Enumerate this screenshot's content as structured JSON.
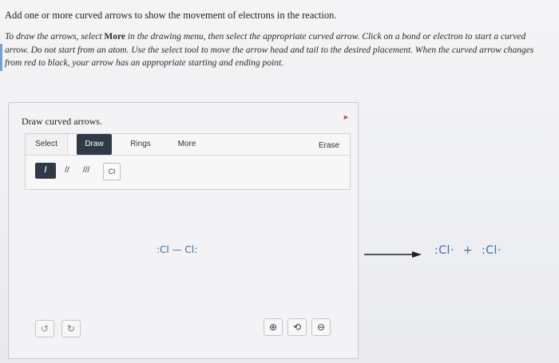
{
  "question": {
    "title": "Add one or more curved arrows to show the movement of electrons in the reaction.",
    "instructions_part1": "To draw the arrows, select ",
    "instructions_bold": "More",
    "instructions_part2": " in the drawing menu, then select the appropriate curved arrow. Click on a bond or electron to start a curved arrow. Do not start from an atom. Use the select tool to move the arrow head and tail to the desired placement. When the curved arrow changes from red to black, your arrow has an appropriate starting and ending point."
  },
  "panel": {
    "title": "Draw curved arrows.",
    "tabs": {
      "select": "Select",
      "draw": "Draw",
      "rings": "Rings",
      "more": "More",
      "erase": "Erase"
    },
    "tools": {
      "single_bond": "/",
      "double_bond": "//",
      "triple_bond": "///",
      "element": "Cl"
    },
    "reactant": ":Cl — Cl:",
    "undo_icon": "undo-icon",
    "redo_icon": "redo-icon",
    "zoom": {
      "in_icon": "zoom-in-icon",
      "reset_icon": "zoom-reset-icon",
      "out_icon": "zoom-out-icon"
    }
  },
  "products": {
    "product1": ":Cl·",
    "plus": "+",
    "product2": ":Cl·"
  },
  "colors": {
    "structure_blue": "#3d6ea8",
    "toolbar_dark": "#2f3a46",
    "marker_red": "#c23b3b"
  }
}
